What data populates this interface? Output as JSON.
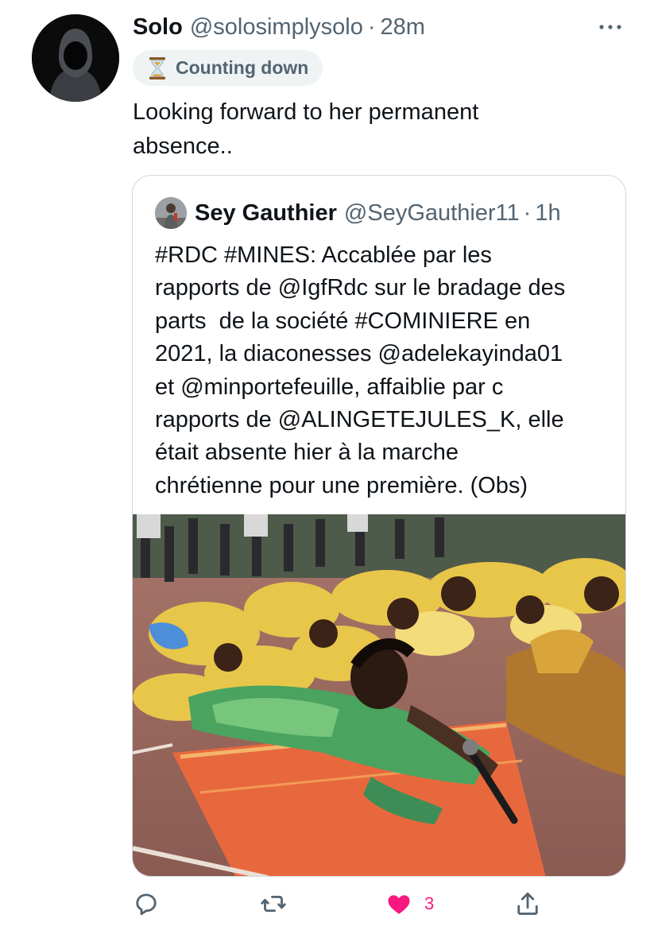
{
  "tweet": {
    "author_name": "Solo",
    "author_handle": "@solosimplysolo",
    "separator": "·",
    "time": "28m",
    "badge_label": "Counting down",
    "text": "Looking forward to her permanent\nabsence.."
  },
  "quote": {
    "author_name": "Sey Gauthier",
    "author_handle": "@SeyGauthier11",
    "separator": "·",
    "time": "1h",
    "text_lines": [
      "#RDC #MINES: Accablée par les",
      "rapports de @IgfRdc sur le bradage des",
      "parts  de la société #COMINIERE en",
      "2021, la diaconesses @adelekayinda01",
      "et @minportefeuille, affaiblie par c",
      "rapports de @ALINGETEJULES_K, elle",
      "était absente hier à la marche",
      "chrétienne pour une première. (Obs)"
    ]
  },
  "actions": {
    "reply_icon": "reply-icon",
    "retweet_icon": "retweet-icon",
    "like_icon": "heart-filled-icon",
    "like_count": "3",
    "share_icon": "share-icon"
  },
  "colors": {
    "text": "#0f1419",
    "secondary": "#536471",
    "border": "#cfd9de",
    "like": "#f91880",
    "badge_bg": "#eff3f4"
  }
}
